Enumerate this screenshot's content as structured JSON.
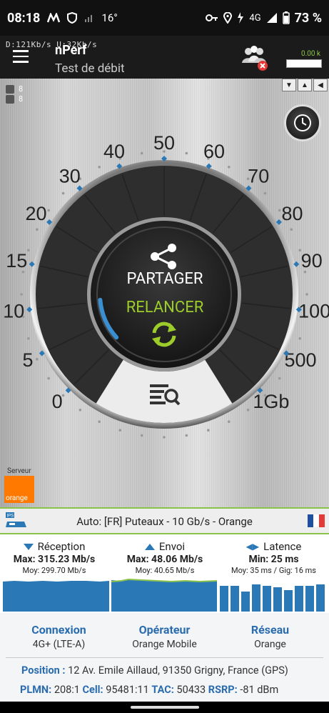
{
  "status": {
    "time": "08:18",
    "temperature": "16°",
    "network": "4G",
    "battery": "73 %",
    "icons": [
      "m-icon",
      "shield-icon",
      "signal-icon",
      "key-icon",
      "location-icon",
      "vibrate-icon",
      "signal-full-icon",
      "battery-icon"
    ]
  },
  "appbar": {
    "rates": "D:121Kb/s  U:32Kb/s",
    "title": "nPerf",
    "subtitle": "Test de débit",
    "data_value": "0.00 k"
  },
  "counters": {
    "users_1": "8",
    "users_2": "8"
  },
  "gauge": {
    "ticks": [
      "0",
      "5",
      "10",
      "15",
      "20",
      "30",
      "40",
      "50",
      "60",
      "70",
      "80",
      "90",
      "100",
      "500",
      "1Gb"
    ],
    "share_label": "PARTAGER",
    "restart_label": "RELANCER",
    "colors": {
      "accent_green": "#9ccc2a",
      "arc_blue": "#3a8fd0"
    }
  },
  "server": {
    "label": "Serveur",
    "operator_logo": "orange",
    "ips_badge": "IPS",
    "text": "Auto: [FR] Puteaux - 10 Gb/s - Orange",
    "flag": "france-flag"
  },
  "stats": {
    "reception": {
      "label": "Réception",
      "max": "Max: 315.23 Mb/s",
      "moy": "Moy: 299.70 Mb/s"
    },
    "envoi": {
      "label": "Envoi",
      "max": "Max: 48.06 Mb/s",
      "moy": "Moy: 40.65 Mb/s"
    },
    "latence": {
      "label": "Latence",
      "min": "Min: 25 ms",
      "moy": "Moy: 35 ms / Gig: 16 ms"
    }
  },
  "info": {
    "connexion_label": "Connexion",
    "connexion_value": "4G+ (LTE-A)",
    "operateur_label": "Opérateur",
    "operateur_value": "Orange Mobile",
    "reseau_label": "Réseau",
    "reseau_value": "Orange",
    "position_label": "Position :",
    "position_value": "12 Av. Emile Aillaud, 91350 Grigny, France (GPS)",
    "plmn_label": "PLMN:",
    "plmn_value": "208:1",
    "cell_label": "Cell:",
    "cell_value": "95481:11",
    "tac_label": "TAC:",
    "tac_value": "50433",
    "rsrp_label": "RSRP:",
    "rsrp_value": "-81 dBm"
  }
}
